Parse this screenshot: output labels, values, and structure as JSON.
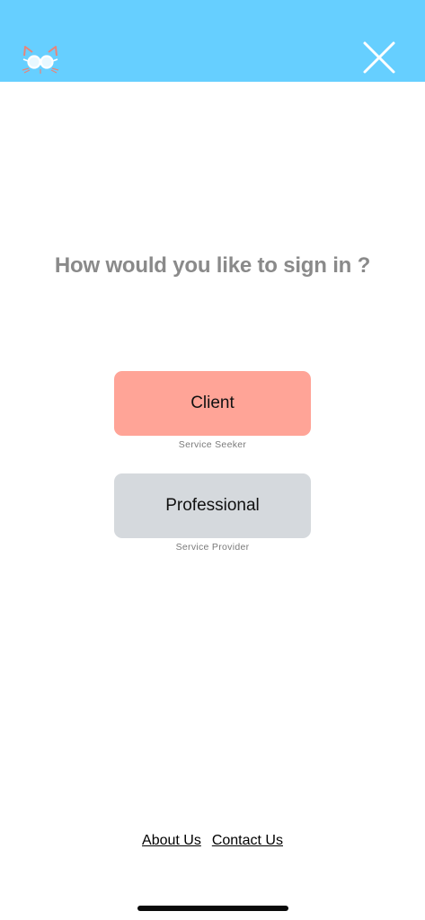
{
  "header": {
    "background_color": "#66cfff",
    "logo_icon": "cat-glasses-logo-icon",
    "close_icon": "close-icon"
  },
  "main": {
    "title": "How would you like to sign in ?",
    "options": [
      {
        "label": "Client",
        "caption": "Service Seeker",
        "color": "#ffa497"
      },
      {
        "label": "Professional",
        "caption": "Service Provider",
        "color": "#d5d9dd"
      }
    ]
  },
  "footer": {
    "about_label": "About Us",
    "contact_label": "Contact Us"
  }
}
